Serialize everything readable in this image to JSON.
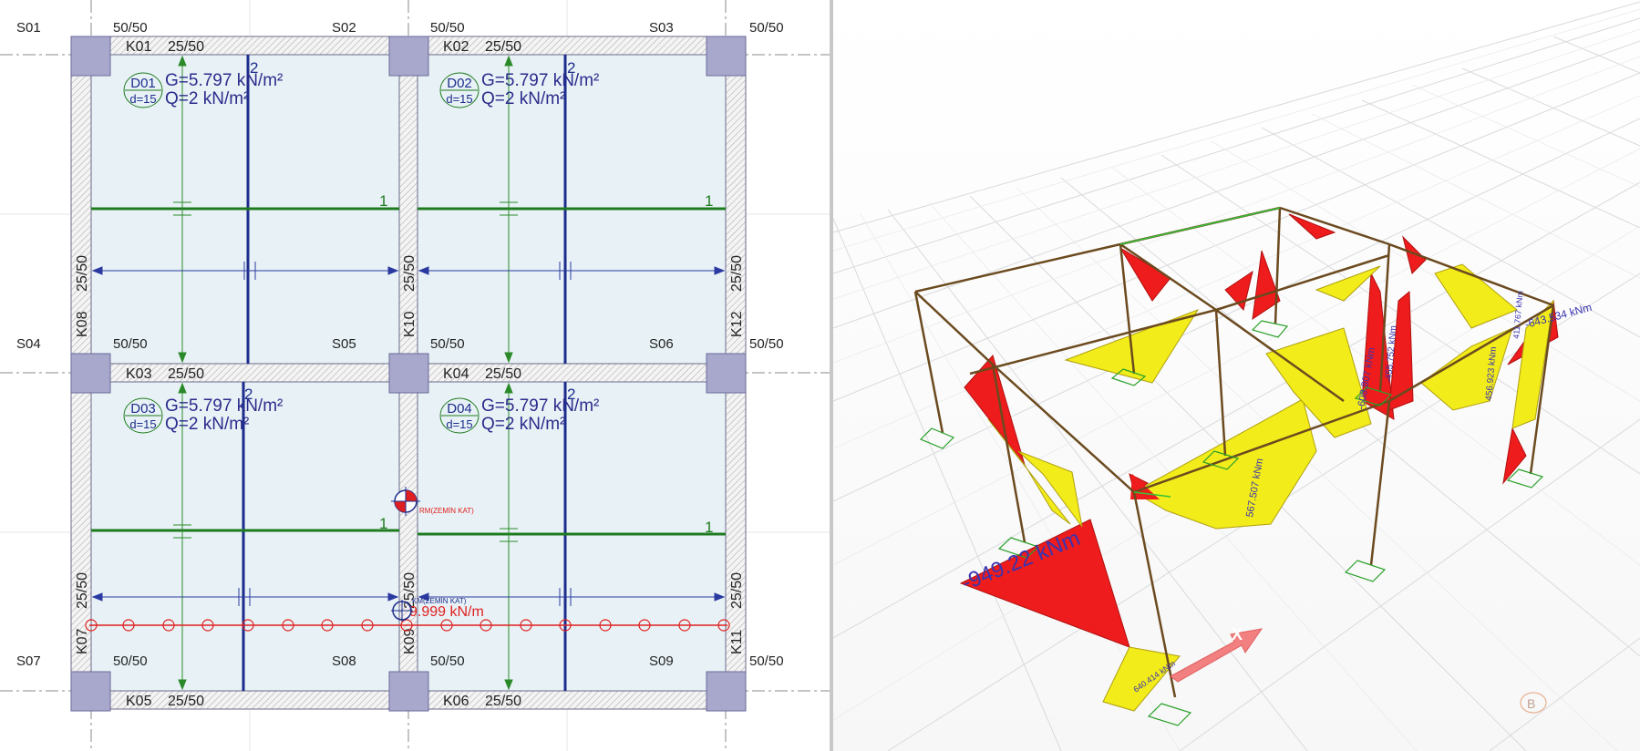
{
  "plan": {
    "columns": [
      {
        "id": "S01",
        "size": "50/50"
      },
      {
        "id": "S02",
        "size": "50/50"
      },
      {
        "id": "S03",
        "size": "50/50"
      },
      {
        "id": "S04",
        "size": "50/50"
      },
      {
        "id": "S05",
        "size": "50/50"
      },
      {
        "id": "S06",
        "size": "50/50"
      },
      {
        "id": "S07",
        "size": "50/50"
      },
      {
        "id": "S08",
        "size": "50/50"
      },
      {
        "id": "S09",
        "size": "50/50"
      }
    ],
    "beams": [
      {
        "id": "K01",
        "size": "25/50"
      },
      {
        "id": "K02",
        "size": "25/50"
      },
      {
        "id": "K03",
        "size": "25/50"
      },
      {
        "id": "K04",
        "size": "25/50"
      },
      {
        "id": "K05",
        "size": "25/50"
      },
      {
        "id": "K06",
        "size": "25/50"
      },
      {
        "id": "K07",
        "size": "25/50"
      },
      {
        "id": "K08",
        "size": "25/50"
      },
      {
        "id": "K09",
        "size": "25/50"
      },
      {
        "id": "K10",
        "size": "25/50"
      },
      {
        "id": "K11",
        "size": "25/50"
      },
      {
        "id": "K12",
        "size": "25/50"
      }
    ],
    "slabs": [
      {
        "id": "D01",
        "thickness": "d=15",
        "dead_load": "G=5.797 kN/m²",
        "live_load": "Q=2 kN/m²"
      },
      {
        "id": "D02",
        "thickness": "d=15",
        "dead_load": "G=5.797 kN/m²",
        "live_load": "Q=2 kN/m²"
      },
      {
        "id": "D03",
        "thickness": "d=15",
        "dead_load": "G=5.797 kN/m²",
        "live_load": "Q=2 kN/m²"
      },
      {
        "id": "D04",
        "thickness": "d=15",
        "dead_load": "G=5.797 kN/m²",
        "live_load": "Q=2 kN/m²"
      }
    ],
    "direction_labels": {
      "dir1": "1",
      "dir2": "2"
    },
    "center_of_mass_label": "KM(ZEMİN KAT)",
    "center_of_rigidity_label": "RM(ZEMİN KAT)",
    "line_load_label": "9.999 kN/m"
  },
  "view3d": {
    "moment_labels": [
      "-949.22 kNm",
      "-643.534 kNm",
      "640.414 kNm",
      "567.507 kNm",
      "-608.807 kNm",
      "-455.752 kNm",
      "456.923 kNm",
      "411.767 kNm"
    ],
    "axis_x_label": "X",
    "axis_marker_label": "B"
  },
  "colors": {
    "slab_fill": "#e8f2f6",
    "column_fill": "#a8a8cc",
    "beam_hatch": "#bdbdbd",
    "load_text": "#2b2b8c",
    "rebar_dir1": "#1e7a1e",
    "rebar_dir2": "#1c2c8c",
    "load_line": "#e02020",
    "moment_negative": "#ee1c1c",
    "moment_positive": "#f2ec1a",
    "frame_member": "#6b4a1f"
  }
}
